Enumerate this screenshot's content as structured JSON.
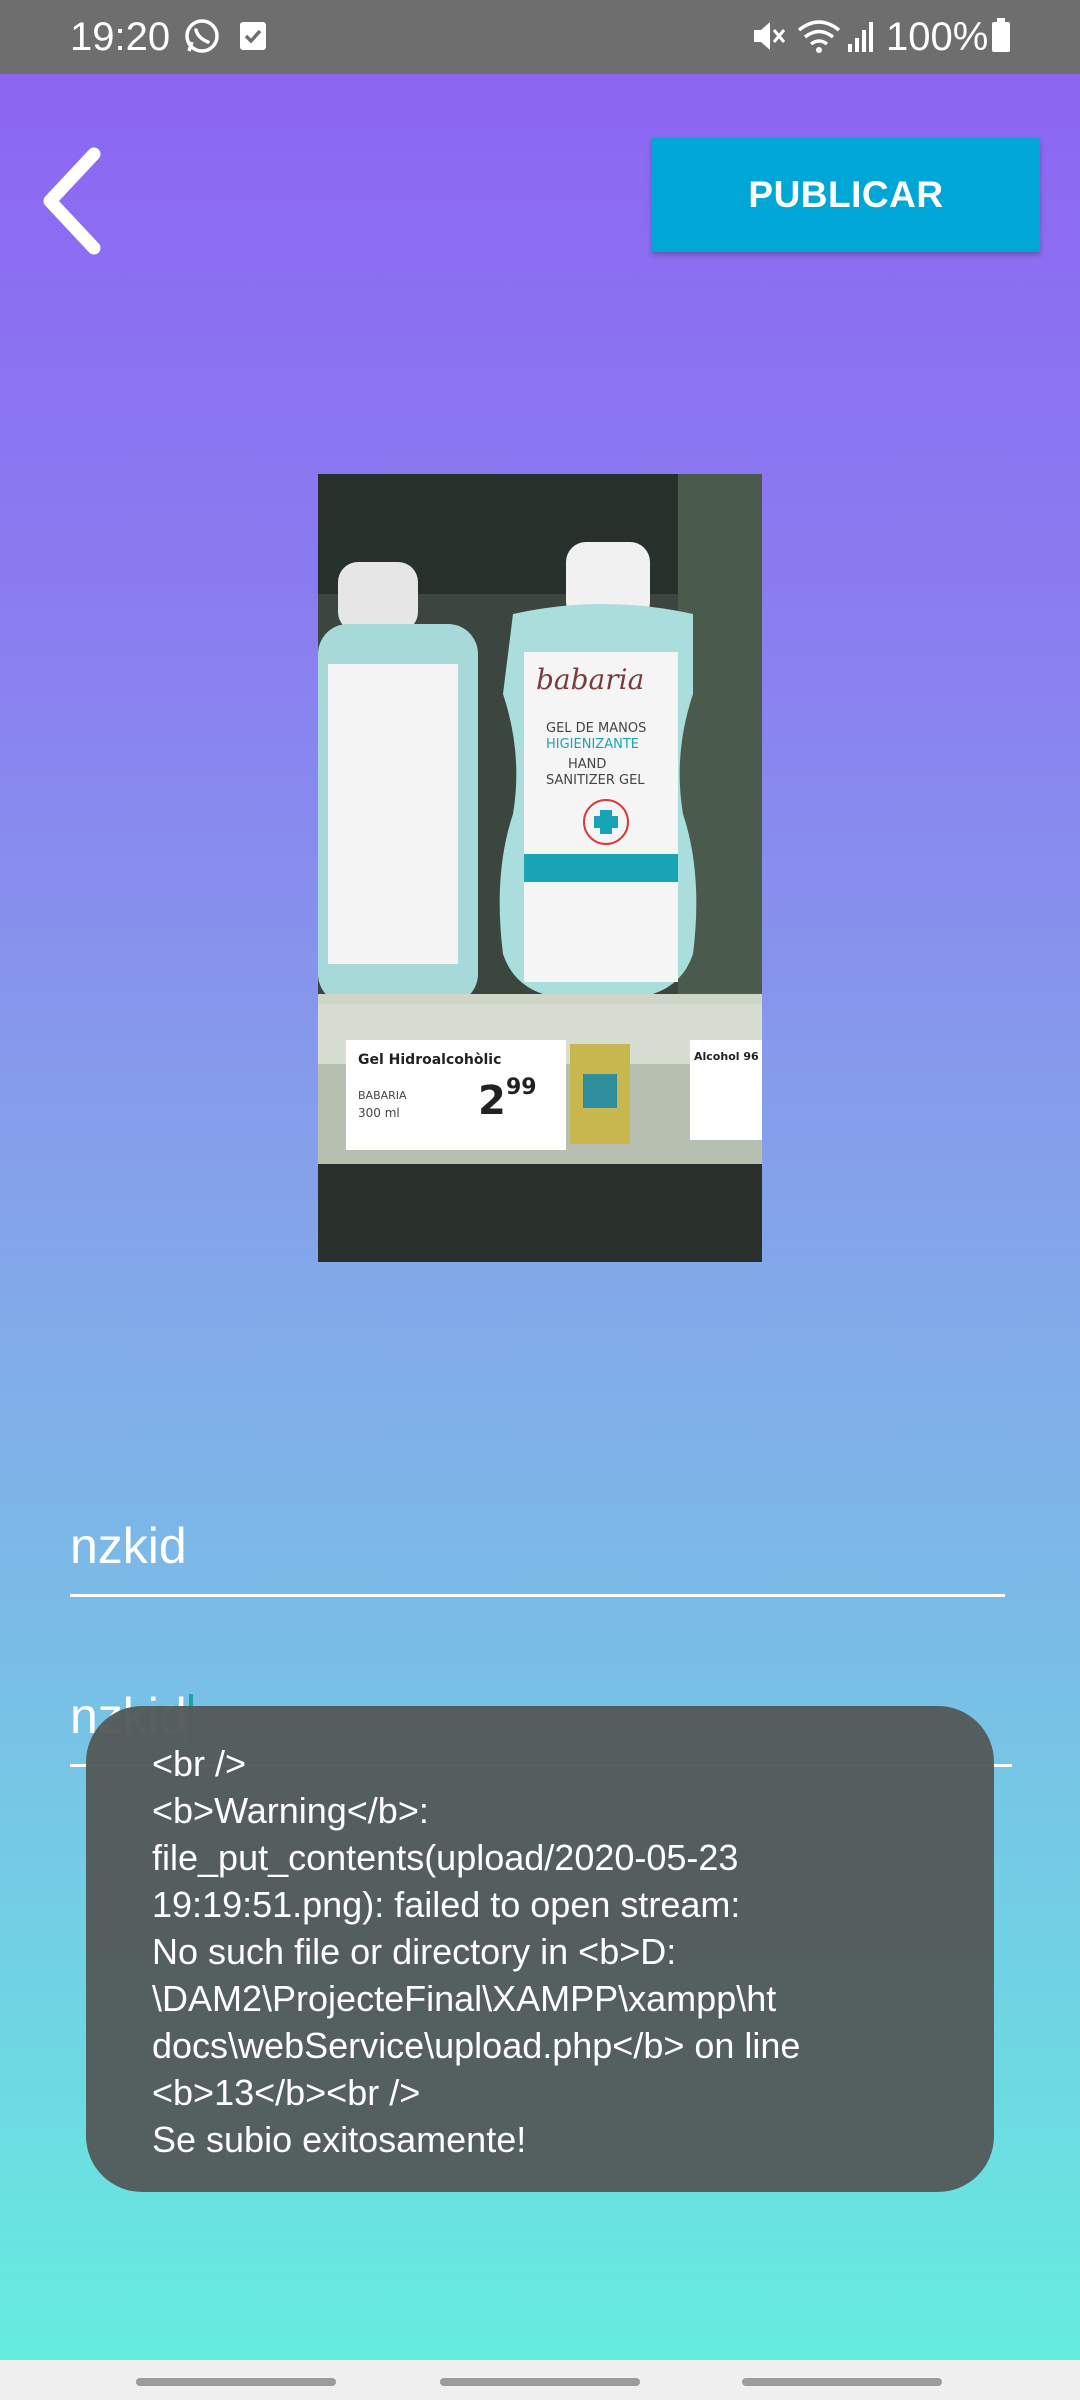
{
  "status_bar": {
    "time": "19:20",
    "battery": "100%",
    "icons": [
      "whatsapp-icon",
      "checkbox-icon",
      "mute-icon",
      "wifi-icon",
      "signal-icon",
      "battery-icon"
    ]
  },
  "header": {
    "back_icon": "chevron-left-icon",
    "publish_label": "PUBLICAR"
  },
  "photo": {
    "description_icon": "product-photo"
  },
  "fields": {
    "first_value": "nzkid",
    "second_value": "nzkid"
  },
  "toast": {
    "lines": [
      "<br />",
      "<b>Warning</b>:",
      "file_put_contents(upload/2020-05-23",
      "19:19:51.png): failed to open stream:",
      "No such file or directory in <b>D:",
      "\\DAM2\\ProjecteFinal\\XAMPP\\xampp\\ht",
      "docs\\webService\\upload.php</b> on line",
      "<b>13</b><br />",
      "Se subio exitosamente!"
    ]
  },
  "colors": {
    "gradient_top": "#8c66f2",
    "gradient_bottom": "#65ecdf",
    "publish_button": "#00a6d6",
    "toast_bg": "#535a5a"
  }
}
